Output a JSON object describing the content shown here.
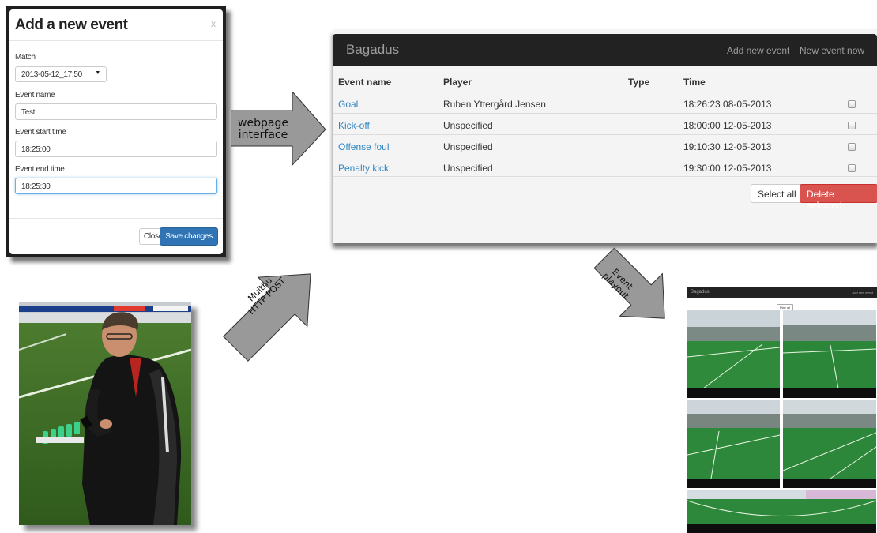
{
  "modal": {
    "title": "Add a new event",
    "close_symbol": "x",
    "match_label": "Match",
    "match_value": "2013-05-12_17:50",
    "event_name_label": "Event name",
    "event_name_value": "Test",
    "start_label": "Event start time",
    "start_value": "18:25:00",
    "end_label": "Event end time",
    "end_value": "18:25:30",
    "close_button": "Close",
    "save_button": "Save changes"
  },
  "arrows": {
    "webpage_line1": "webpage",
    "webpage_line2": "interface",
    "muithu_line1": "Muithu",
    "muithu_line2": "HTTP POST",
    "event_line1": "Event",
    "event_line2": "playout"
  },
  "webpage": {
    "brand": "Bagadus",
    "nav": [
      "Add new event",
      "New event now"
    ],
    "columns": [
      "Event name",
      "Player",
      "Type",
      "Time"
    ],
    "rows": [
      {
        "event": "Goal",
        "player": "Ruben Yttergård Jensen",
        "type": "",
        "time": "18:26:23 08-05-2013"
      },
      {
        "event": "Kick-off",
        "player": "Unspecified",
        "type": "",
        "time": "18:00:00 12-05-2013"
      },
      {
        "event": "Offense foul",
        "player": "Unspecified",
        "type": "",
        "time": "19:10:30 12-05-2013"
      },
      {
        "event": "Penalty kick",
        "player": "Unspecified",
        "type": "",
        "time": "19:30:00 12-05-2013"
      }
    ],
    "select_all": "Select all",
    "delete_selected": "Delete selected"
  },
  "playout": {
    "brand": "Bagadus",
    "nav": "Add new event",
    "play_all": "Play all"
  },
  "colors": {
    "navbar": "#222222",
    "link": "#2f86c2",
    "danger": "#d9534f",
    "primary": "#3174b6",
    "arrow_fill": "#999999"
  }
}
